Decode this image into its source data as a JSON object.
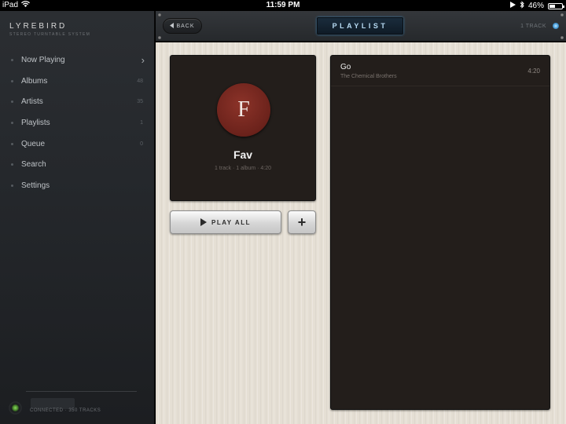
{
  "status_bar": {
    "carrier": "iPad",
    "time": "11:59 PM",
    "battery": "46%",
    "battery_level": 0.46
  },
  "sidebar": {
    "brand": "LYREBIRD",
    "brand_sub": "STEREO TURNTABLE SYSTEM",
    "items": [
      {
        "label": "Now Playing",
        "count": "",
        "chevron": true
      },
      {
        "label": "Albums",
        "count": "48"
      },
      {
        "label": "Artists",
        "count": "35"
      },
      {
        "label": "Playlists",
        "count": "1"
      },
      {
        "label": "Queue",
        "count": "0"
      },
      {
        "label": "Search",
        "count": ""
      },
      {
        "label": "Settings",
        "count": ""
      }
    ],
    "connection": "CONNECTED · 350 TRACKS"
  },
  "header": {
    "back_label": "BACK",
    "title": "PLAYLIST",
    "track_count": "1 TRACK"
  },
  "playlist": {
    "initial": "F",
    "name": "Fav",
    "meta": "1 track · 1 album · 4:20",
    "play_all_label": "PLAY ALL",
    "add_label": "+"
  },
  "tracks": [
    {
      "title": "Go",
      "artist": "The Chemical Brothers",
      "duration": "4:20"
    }
  ],
  "colors": {
    "title_glow": "#3a7aa8",
    "avatar": "#6b221b",
    "connection_led": "#8ad860"
  }
}
